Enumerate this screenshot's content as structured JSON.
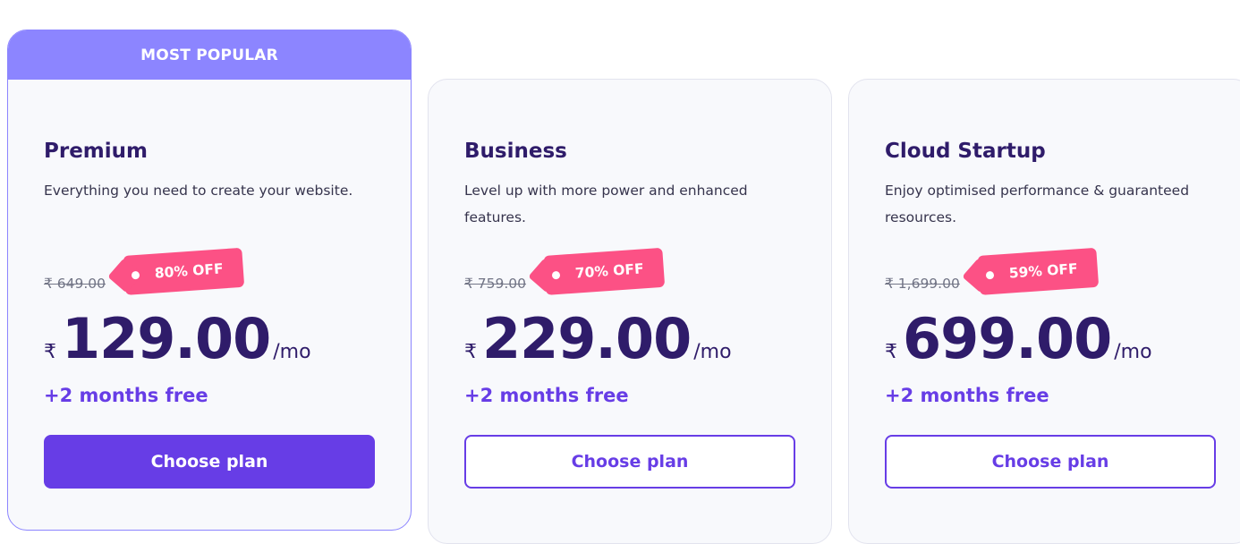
{
  "plans": [
    {
      "ribbon": "MOST POPULAR",
      "name": "Premium",
      "description": "Everything you need to create your website.",
      "old_price": "₹ 649.00",
      "discount": "80% OFF",
      "currency": "₹",
      "price": "129.00",
      "period": "/mo",
      "bonus": "+2 months free",
      "cta": "Choose plan"
    },
    {
      "name": "Business",
      "description": "Level up with more power and enhanced features.",
      "old_price": "₹ 759.00",
      "discount": "70% OFF",
      "currency": "₹",
      "price": "229.00",
      "period": "/mo",
      "bonus": "+2 months free",
      "cta": "Choose plan"
    },
    {
      "name": "Cloud Startup",
      "description": "Enjoy optimised performance & guaranteed resources.",
      "old_price": "₹ 1,699.00",
      "discount": "59% OFF",
      "currency": "₹",
      "price": "699.00",
      "period": "/mo",
      "bonus": "+2 months free",
      "cta": "Choose plan"
    }
  ],
  "colors": {
    "accent": "#673de6",
    "ribbon": "#8c85ff",
    "discount_tag": "#fc5185",
    "heading": "#2f1c6a"
  }
}
